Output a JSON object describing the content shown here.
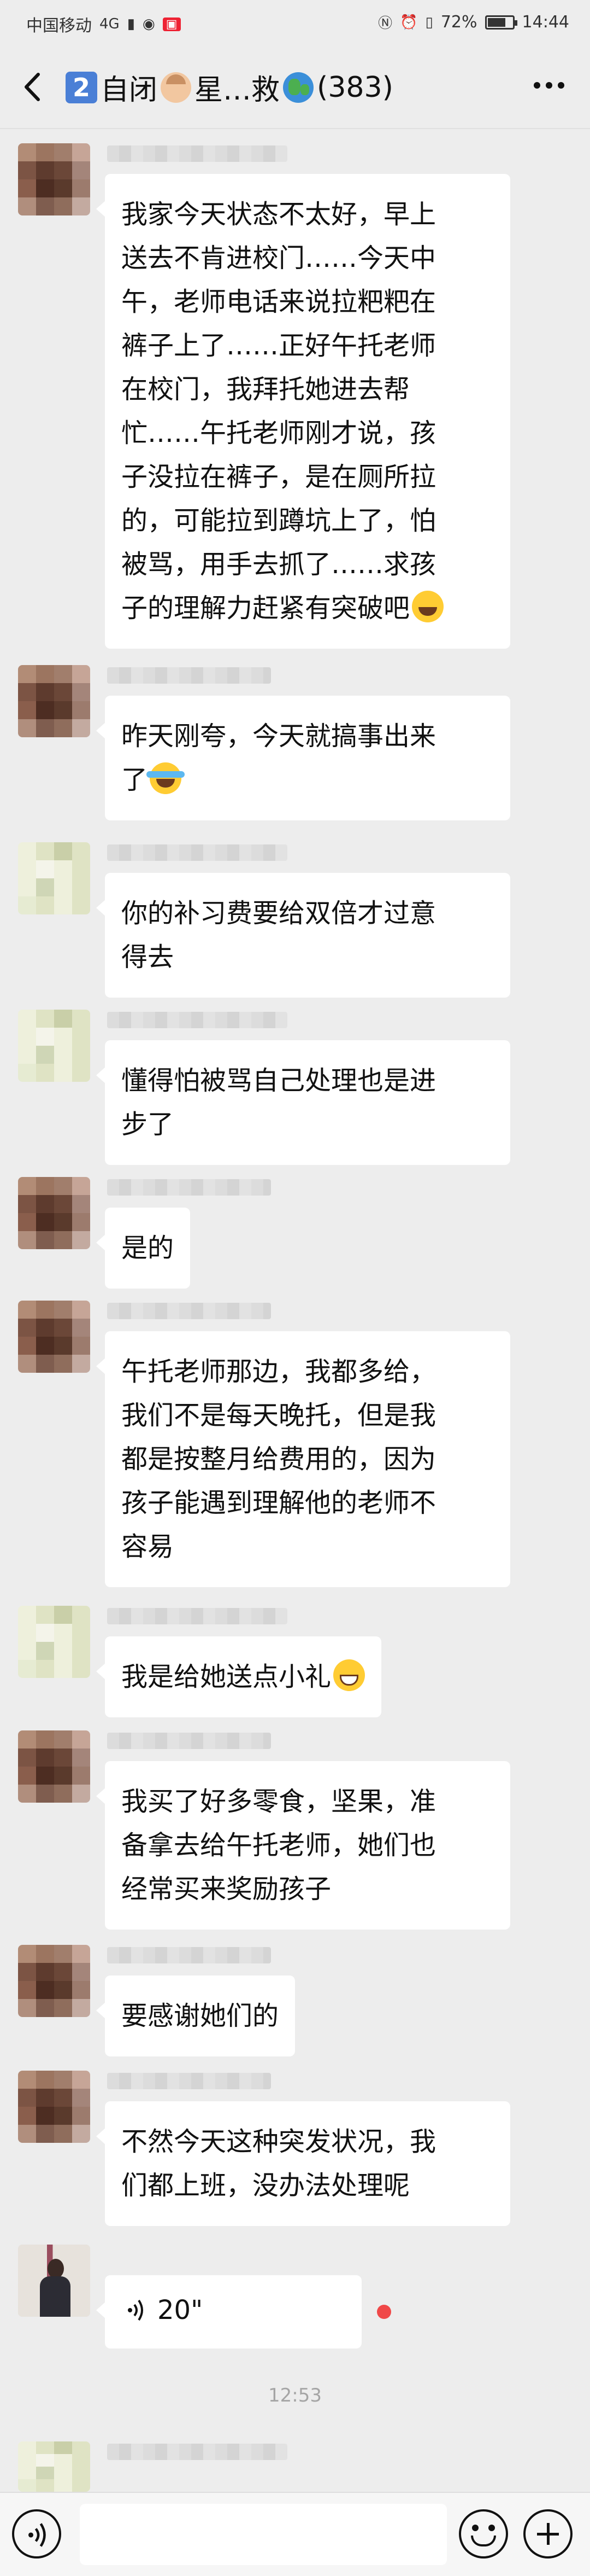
{
  "status_bar": {
    "carrier": "中国移动",
    "network": "4G",
    "battery_text": "72%",
    "battery_level": 0.72,
    "time": "14:44"
  },
  "header": {
    "badge_number": "2",
    "title_part1": "自闭",
    "title_part2": "星…救",
    "member_count": "(383)"
  },
  "messages": [
    {
      "text": "我家今天状态不太好，早上\n送去不肯进校门……今天中\n午，老师电话来说拉粑粑在\n裤子上了……正好午托老师\n在校门，我拜托她进去帮\n忙……午托老师刚才说，孩\n子没拉在裤子，是在厕所拉\n的，可能拉到蹲坑上了，怕\n被骂，用手去抓了……求孩\n子的理解力赶紧有突破吧",
      "emoji": "joy"
    },
    {
      "text": "昨天刚夸，今天就搞事出来\n了",
      "emoji": "tears"
    },
    {
      "text": "你的补习费要给双倍才过意\n得去",
      "emoji": ""
    },
    {
      "text": "懂得怕被骂自己处理也是进\n步了",
      "emoji": ""
    },
    {
      "text": "是的",
      "emoji": ""
    },
    {
      "text": "午托老师那边，我都多给，\n我们不是每天晚托，但是我\n都是按整月给费用的，因为\n孩子能遇到理解他的老师不\n容易",
      "emoji": ""
    },
    {
      "text": "我是给她送点小礼",
      "emoji": "grin"
    },
    {
      "text": "我买了好多零食，坚果，准\n备拿去给午托老师，她们也\n经常买来奖励孩子",
      "emoji": ""
    },
    {
      "text": "要感谢她们的",
      "emoji": ""
    },
    {
      "text": "不然今天这种突发状况，我\n们都上班，没办法处理呢",
      "emoji": ""
    }
  ],
  "voice_message": {
    "duration": "20\""
  },
  "timestamp": "12:53",
  "colors": {
    "background": "#ededed",
    "bubble": "#ffffff",
    "unread": "#f04848"
  }
}
